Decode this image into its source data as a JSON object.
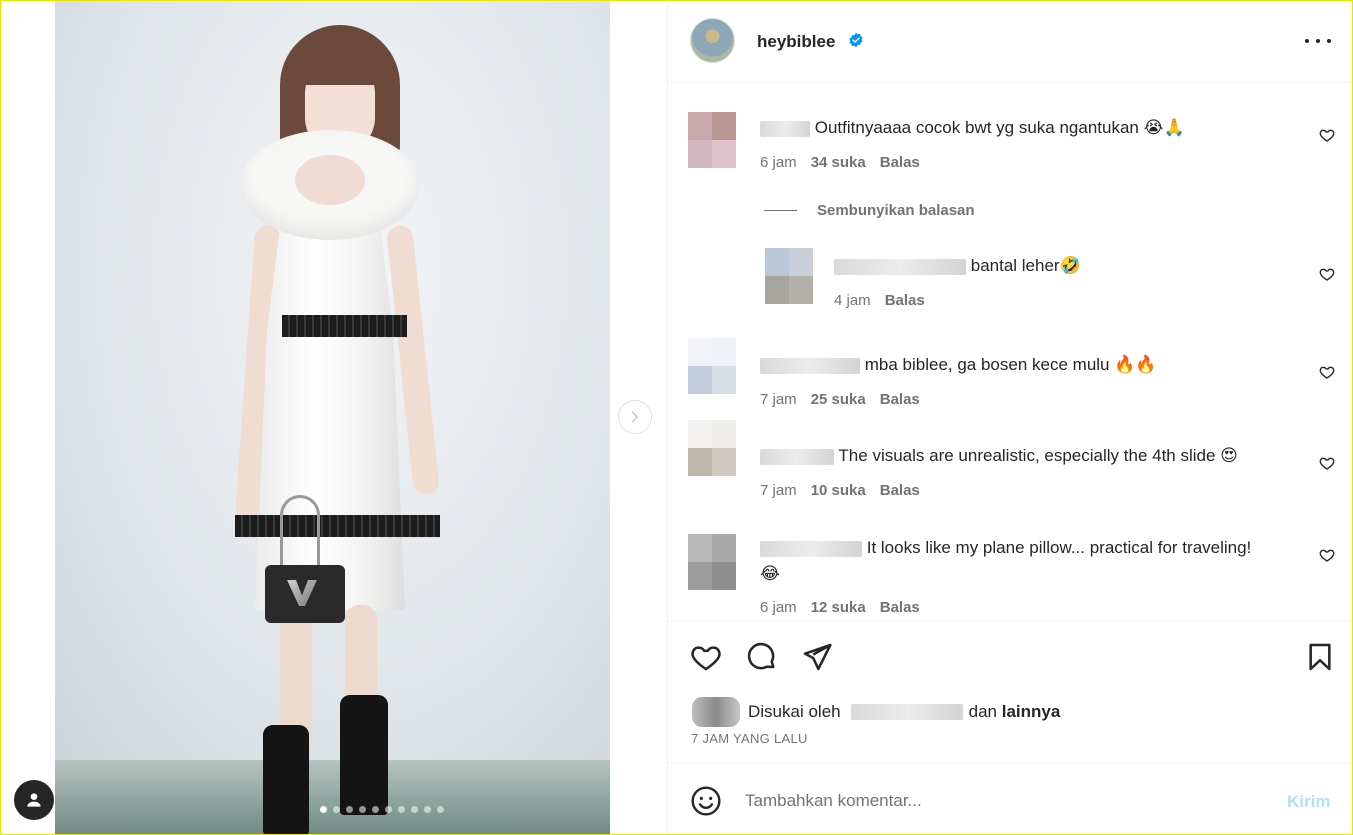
{
  "post": {
    "owner": "heybiblee",
    "verified": true,
    "carousel": {
      "total_slides": 10,
      "active_slide": 1
    }
  },
  "comments": [
    {
      "username_blurred": "...lit...",
      "text": "Outfitnyaaaa cocok bwt yg suka ngantukan 😭🙏",
      "time": "6 jam",
      "likes": "34 suka",
      "reply_label": "Balas",
      "hide_replies_label": "Sembunyikan balasan",
      "replies": [
        {
          "text": "bantal leher🤣",
          "time": "4 jam",
          "reply_label": "Balas"
        }
      ]
    },
    {
      "text": "mba biblee, ga bosen kece mulu 🔥🔥",
      "time": "7 jam",
      "likes": "25 suka",
      "reply_label": "Balas"
    },
    {
      "text": "The visuals are unrealistic, especially the 4th slide 😍",
      "time": "7 jam",
      "likes": "10 suka",
      "reply_label": "Balas"
    },
    {
      "text": "It looks like my plane pillow... practical for traveling! 😂",
      "time": "6 jam",
      "likes": "12 suka",
      "reply_label": "Balas"
    }
  ],
  "likes_summary": {
    "prefix": "Disukai oleh",
    "middle": "dan",
    "suffix": "lainnya"
  },
  "time_ago": "7 JAM YANG LALU",
  "add_comment": {
    "placeholder": "Tambahkan komentar...",
    "post_label": "Kirim"
  },
  "icons": {
    "like": "heart-icon",
    "comment": "comment-bubble-icon",
    "share": "paper-plane-icon",
    "save": "bookmark-icon",
    "more": "more-horizontal-icon",
    "emoji": "smiley-icon",
    "next": "chevron-right-icon",
    "verified": "verified-badge-icon"
  },
  "colors": {
    "accent_link": "#b2dffc",
    "verified": "#0095f6",
    "text": "#262626",
    "muted": "#737373"
  }
}
